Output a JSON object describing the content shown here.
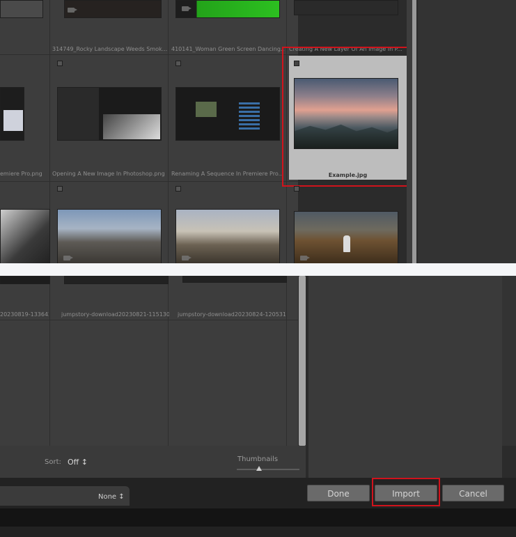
{
  "grid": {
    "row1_labels": [
      "",
      "314749_Rocky Landscape Weeds Smok...",
      "410141_Woman Green Screen Dancing...",
      "Creating A New Layer Of An Image In P..."
    ],
    "row2_labels": [
      "emiere Pro.png",
      "Opening A New Image In Photoshop.png",
      "Renaming A Sequence In Premiere Pro...",
      "Example.jpg"
    ],
    "row4_labels": [
      "20230819-133642...",
      "jumpstory-download20230821-115130...",
      "jumpstory-download20230824-120531..."
    ]
  },
  "toolbar": {
    "sort_label": "Sort:",
    "sort_value": "Off ↕",
    "thumbnails_label": "Thumbnails"
  },
  "footer": {
    "none_label": "None ↕",
    "done_label": "Done",
    "import_label": "Import",
    "cancel_label": "Cancel"
  },
  "colors": {
    "highlight_red": "#d1131c",
    "selected_cell": "#bdbdbd"
  }
}
